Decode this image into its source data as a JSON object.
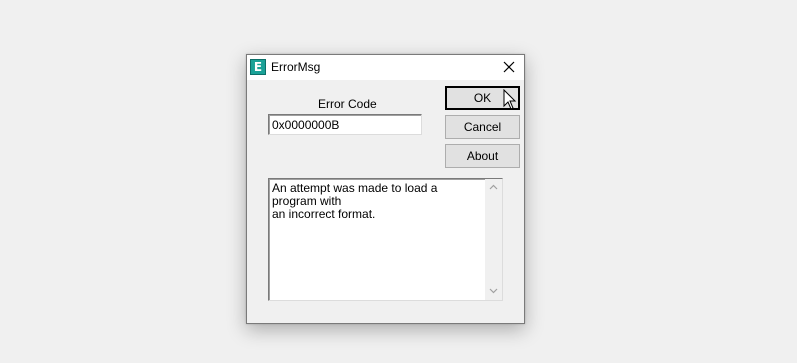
{
  "window": {
    "title": "ErrorMsg",
    "icon": "E"
  },
  "form": {
    "error_code_label": "Error Code",
    "error_code_value": "0x0000000B",
    "message": "An attempt was made to load a program with\nan incorrect format."
  },
  "buttons": {
    "ok": "OK",
    "cancel": "Cancel",
    "about": "About"
  },
  "icons": {
    "app": "app-icon",
    "close": "close-icon",
    "cursor": "mouse-pointer-icon",
    "scroll_up": "chevron-up-icon",
    "scroll_down": "chevron-down-icon"
  },
  "colors": {
    "app_icon": "#1aa197",
    "window_bg": "#f0f0f0",
    "titlebar_bg": "#ffffff"
  }
}
